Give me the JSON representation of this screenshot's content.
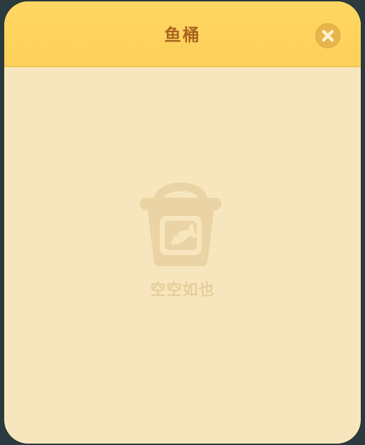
{
  "dialog": {
    "title": "鱼桶",
    "close_icon": "close-icon",
    "accent_color": "#fcd05a",
    "background_color": "#f7e6bd"
  },
  "empty_state": {
    "icon": "fish-bucket-icon",
    "message": "空空如也"
  }
}
